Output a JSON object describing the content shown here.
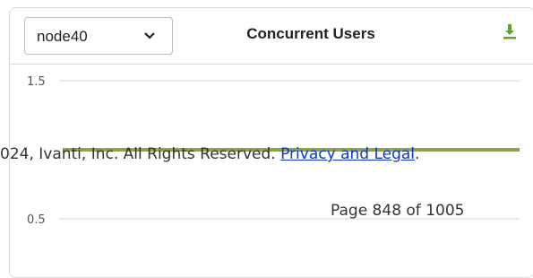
{
  "node_select": {
    "value": "node40",
    "icon": "chevron-down-icon"
  },
  "chart_title": "Concurrent Users",
  "download_icon": "download-icon",
  "colors": {
    "accent_green": "#5aa52c",
    "series_line": "#8ca34a",
    "grid": "#d6d6d6"
  },
  "chart_data": {
    "type": "line",
    "title": "Concurrent Users",
    "yticks": [
      1.5,
      0.5
    ],
    "ytick_labels": [
      "1.5",
      "0.5"
    ],
    "ylim_visible": [
      0.5,
      1.5
    ],
    "grid": true,
    "series": [
      {
        "values": [
          1,
          1
        ]
      }
    ]
  },
  "overlay": {
    "copyright": "024, Ivanti, Inc. All Rights Reserved.",
    "link": "Privacy and Legal",
    "period": ".",
    "page": "Page 848 of 1005"
  }
}
